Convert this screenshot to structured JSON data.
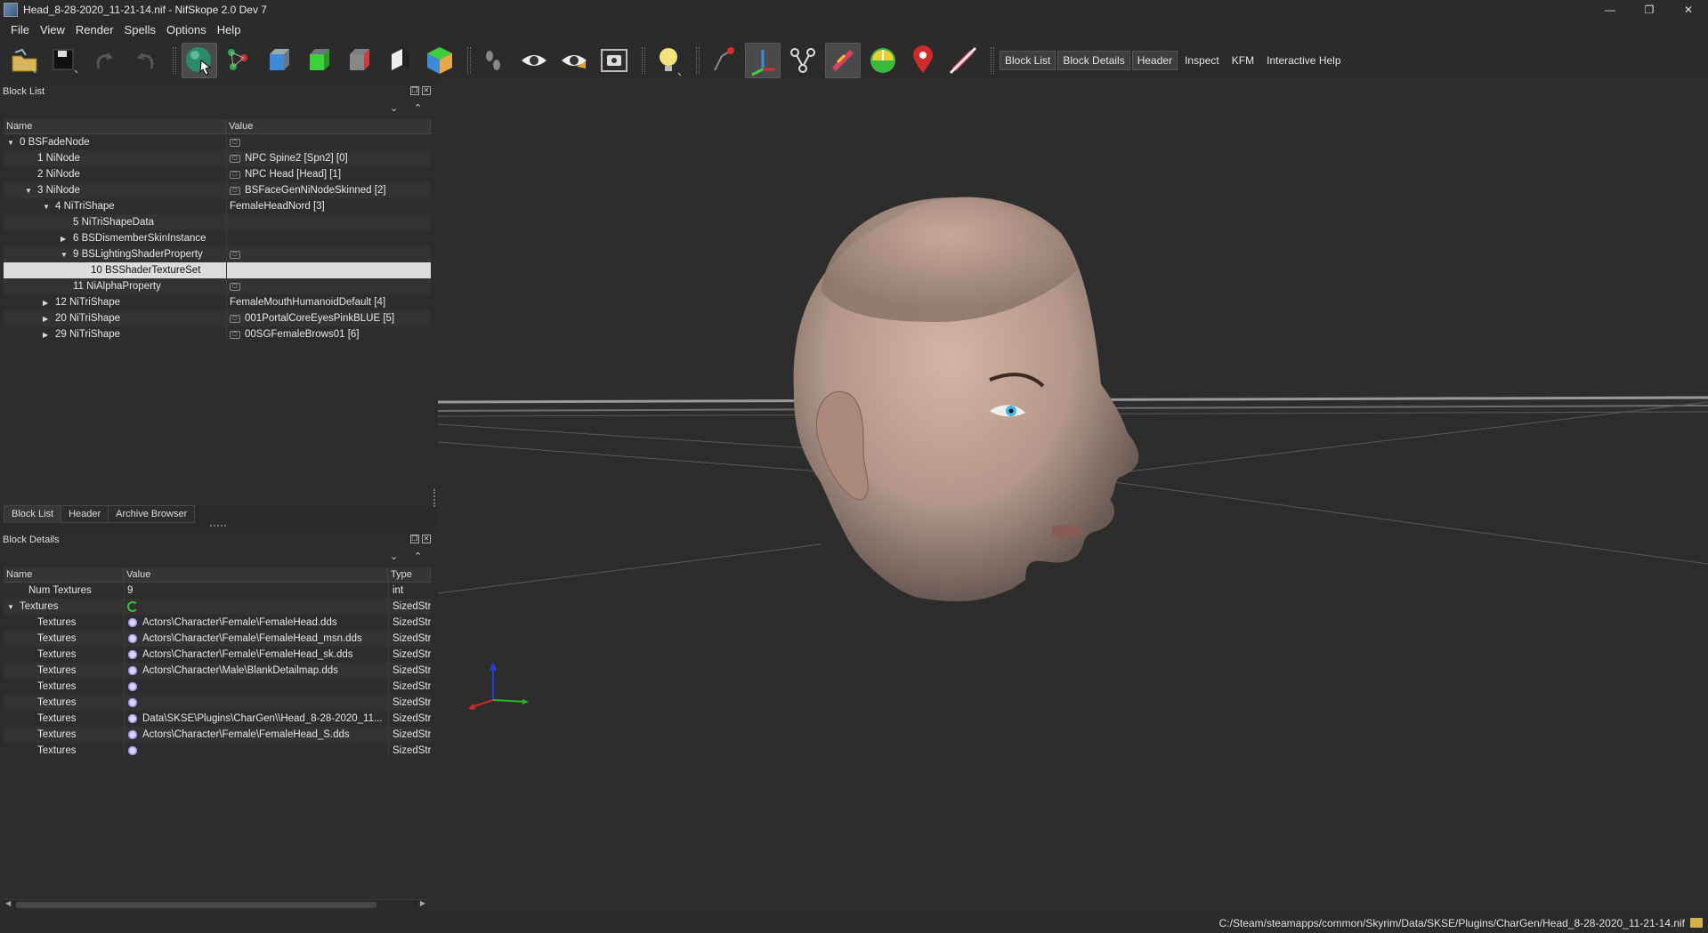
{
  "window": {
    "title": "Head_8-28-2020_11-21-14.nif - NifSkope 2.0 Dev 7",
    "controls": [
      "—",
      "❐",
      "✕"
    ]
  },
  "menu": [
    "File",
    "View",
    "Render",
    "Spells",
    "Options",
    "Help"
  ],
  "toolbar": {
    "icons": [
      "open-icon",
      "save-icon",
      "undo-icon",
      "redo-icon",
      "select-object-icon",
      "select-vertex-icon",
      "view-front-icon",
      "view-side-icon",
      "view-top-icon",
      "view-walk-icon",
      "view-user-icon",
      "show-nodes-icon",
      "show-hidden-icon",
      "show-markers-icon",
      "screenshot-icon",
      "lighting-icon",
      "show-axes-icon",
      "show-constraints-icon",
      "show-skeleton-icon",
      "show-collision-icon",
      "show-vertex-colors-icon",
      "show-havok-icon",
      "disable-shading-icon"
    ],
    "panel_buttons": [
      "Block List",
      "Block Details",
      "Header",
      "Inspect",
      "KFM",
      "Interactive Help"
    ]
  },
  "block_list": {
    "title": "Block List",
    "columns": [
      "Name",
      "Value"
    ],
    "rows": [
      {
        "indent": 0,
        "arrow": "down",
        "name": "0 BSFadeNode",
        "icon": true,
        "value": ""
      },
      {
        "indent": 1,
        "arrow": "",
        "name": "1 NiNode",
        "icon": true,
        "value": "NPC Spine2 [Spn2] [0]"
      },
      {
        "indent": 1,
        "arrow": "",
        "name": "2 NiNode",
        "icon": true,
        "value": "NPC Head [Head] [1]"
      },
      {
        "indent": 1,
        "arrow": "down",
        "name": "3 NiNode",
        "icon": true,
        "value": "BSFaceGenNiNodeSkinned [2]"
      },
      {
        "indent": 2,
        "arrow": "down",
        "name": "4 NiTriShape",
        "icon": false,
        "value": "FemaleHeadNord [3]"
      },
      {
        "indent": 3,
        "arrow": "",
        "name": "5 NiTriShapeData",
        "icon": false,
        "value": ""
      },
      {
        "indent": 3,
        "arrow": "right",
        "name": "6 BSDismemberSkinInstance",
        "icon": false,
        "value": ""
      },
      {
        "indent": 3,
        "arrow": "down",
        "name": "9 BSLightingShaderProperty",
        "icon": true,
        "value": ""
      },
      {
        "indent": 4,
        "arrow": "",
        "name": "10 BSShaderTextureSet",
        "icon": false,
        "value": "",
        "selected": true
      },
      {
        "indent": 3,
        "arrow": "",
        "name": "11 NiAlphaProperty",
        "icon": true,
        "value": ""
      },
      {
        "indent": 2,
        "arrow": "right",
        "name": "12 NiTriShape",
        "icon": false,
        "value": "FemaleMouthHumanoidDefault [4]"
      },
      {
        "indent": 2,
        "arrow": "right",
        "name": "20 NiTriShape",
        "icon": true,
        "value": "001PortalCoreEyesPinkBLUE [5]"
      },
      {
        "indent": 2,
        "arrow": "right",
        "name": "29 NiTriShape",
        "icon": true,
        "value": "00SGFemaleBrows01 [6]"
      }
    ]
  },
  "dock_tabs": [
    "Block List",
    "Header",
    "Archive Browser"
  ],
  "block_details": {
    "title": "Block Details",
    "columns": [
      "Name",
      "Value",
      "Type"
    ],
    "rows": [
      {
        "indent": 1,
        "arrow": "",
        "name": "Num Textures",
        "icon": "",
        "value": "9",
        "type": "int"
      },
      {
        "indent": 0,
        "arrow": "down",
        "name": "Textures",
        "icon": "refresh",
        "value": "",
        "type": "SizedStri"
      },
      {
        "indent": 2,
        "arrow": "",
        "name": "Textures",
        "icon": "gear",
        "value": "Actors\\Character\\Female\\FemaleHead.dds",
        "type": "SizedStri"
      },
      {
        "indent": 2,
        "arrow": "",
        "name": "Textures",
        "icon": "gear",
        "value": "Actors\\Character\\Female\\FemaleHead_msn.dds",
        "type": "SizedStri"
      },
      {
        "indent": 2,
        "arrow": "",
        "name": "Textures",
        "icon": "gear",
        "value": "Actors\\Character\\Female\\FemaleHead_sk.dds",
        "type": "SizedStri"
      },
      {
        "indent": 2,
        "arrow": "",
        "name": "Textures",
        "icon": "gear",
        "value": "Actors\\Character\\Male\\BlankDetailmap.dds",
        "type": "SizedStri"
      },
      {
        "indent": 2,
        "arrow": "",
        "name": "Textures",
        "icon": "gear",
        "value": "",
        "type": "SizedStri"
      },
      {
        "indent": 2,
        "arrow": "",
        "name": "Textures",
        "icon": "gear",
        "value": "",
        "type": "SizedStri"
      },
      {
        "indent": 2,
        "arrow": "",
        "name": "Textures",
        "icon": "gear",
        "value": "Data\\SKSE\\Plugins\\CharGen\\\\Head_8-28-2020_11...",
        "type": "SizedStri"
      },
      {
        "indent": 2,
        "arrow": "",
        "name": "Textures",
        "icon": "gear",
        "value": "Actors\\Character\\Female\\FemaleHead_S.dds",
        "type": "SizedStri"
      },
      {
        "indent": 2,
        "arrow": "",
        "name": "Textures",
        "icon": "gear",
        "value": "",
        "type": "SizedStri"
      }
    ]
  },
  "status": {
    "path": "C:/Steam/steamapps/common/Skyrim/Data/SKSE/Plugins/CharGen/Head_8-28-2020_11-21-14.nif"
  }
}
